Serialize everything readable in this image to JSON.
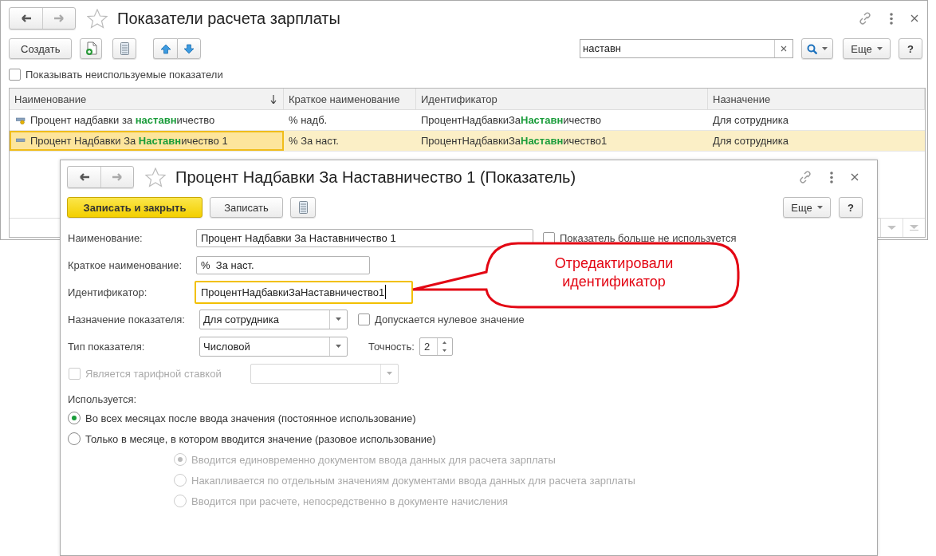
{
  "main_window": {
    "title": "Показатели расчета зарплаты",
    "toolbar": {
      "create_button": "Создать",
      "search": {
        "value": "наставн"
      },
      "more_button": "Еще",
      "help_button": "?"
    },
    "show_unused": {
      "label": "Показывать неиспользуемые показатели",
      "checked": false
    },
    "table": {
      "columns": [
        {
          "label": "Наименование",
          "sorted": true
        },
        {
          "label": "Краткое наименование",
          "sorted": false
        },
        {
          "label": "Идентификатор",
          "sorted": false
        },
        {
          "label": "Назначение",
          "sorted": false
        }
      ],
      "rows": [
        {
          "marked": true,
          "selected": false,
          "cells": [
            "Процент надбавки за **наставн**ичество",
            "% надб.",
            "ПроцентНадбавкиЗа**Наставн**ичество",
            "Для сотрудника"
          ]
        },
        {
          "marked": false,
          "selected": true,
          "cells": [
            "Процент Надбавки За **Наставн**ичество 1",
            "%  За наст.",
            "ПроцентНадбавкиЗа**Наставн**ичество1",
            "Для сотрудника"
          ]
        }
      ]
    }
  },
  "dialog": {
    "title": "Процент Надбавки За Наставничество 1 (Показатель)",
    "save_close_button": "Записать и закрыть",
    "save_button": "Записать",
    "more_button": "Еще",
    "help_button": "?",
    "name": {
      "label": "Наименование:",
      "value": "Процент Надбавки За Наставничество 1",
      "focused": false
    },
    "not_used": {
      "label": "Показатель больше не используется",
      "checked": false,
      "disabled": false
    },
    "short_name": {
      "label": "Краткое наименование:",
      "value": "%  За наст.",
      "focused": false
    },
    "identifier": {
      "label": "Идентификатор:",
      "value": "ПроцентНадбавкиЗаНаставничество1",
      "focused": true
    },
    "purpose": {
      "label": "Назначение показателя:",
      "value": "Для сотрудника",
      "disabled": false
    },
    "zero_allowed": {
      "label": "Допускается нулевое значение",
      "checked": false,
      "disabled": false
    },
    "type": {
      "label": "Тип показателя:",
      "value": "Числовой",
      "disabled": false
    },
    "precision": {
      "label": "Точность:",
      "value": "2"
    },
    "tariff_rate": {
      "label": "Является тарифной ставкой",
      "checked": false,
      "disabled": true
    },
    "tariff_select": {
      "disabled": true
    },
    "usage": {
      "label": "Используется:",
      "options": [
        {
          "label": "Во всех месяцах после ввода значения (постоянное использование)",
          "selected": true,
          "disabled": false
        },
        {
          "label": "Только в месяце, в котором вводится значение (разовое использование)",
          "selected": false,
          "disabled": false,
          "children": [
            {
              "label": "Вводится единовременно документом ввода данных для расчета зарплаты",
              "selected": true,
              "disabled": true
            },
            {
              "label": "Накапливается по отдельным значениям документами ввода данных для расчета зарплаты",
              "selected": false,
              "disabled": true
            },
            {
              "label": "Вводится при расчете, непосредственно в документе начисления",
              "selected": false,
              "disabled": true
            }
          ]
        }
      ]
    }
  },
  "callout": {
    "text": "Отредактировали идентификатор"
  }
}
